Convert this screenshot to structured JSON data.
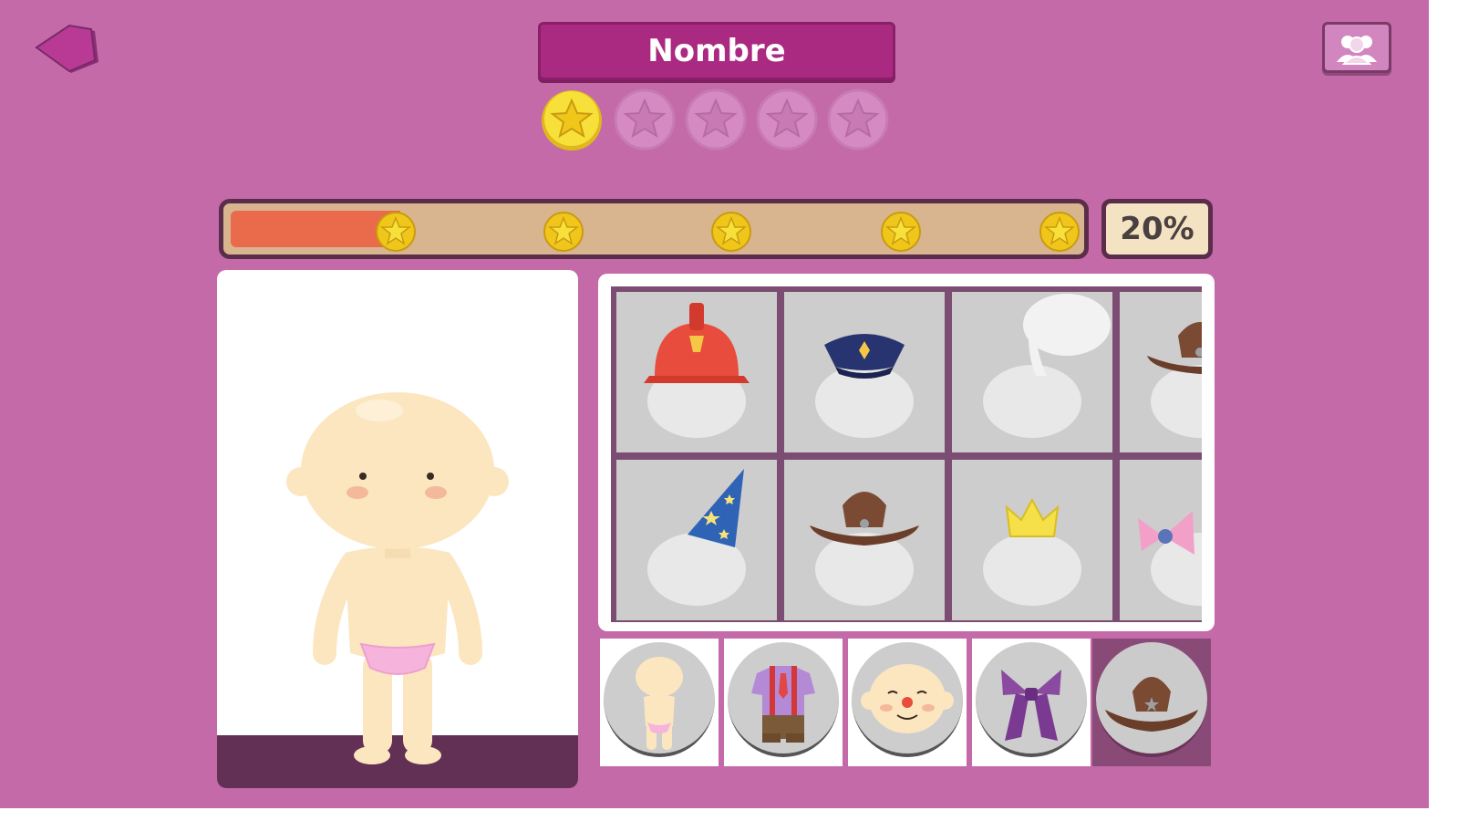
{
  "header": {
    "name_label": "Nombre",
    "back_icon": "back-arrow-icon",
    "users_icon": "users-icon"
  },
  "stars": {
    "earned": 1,
    "total": 5
  },
  "progress": {
    "percent_label": "20%",
    "fraction": 0.2,
    "milestones": 5
  },
  "colors": {
    "background": "#c46aa8",
    "banner": "#aa2981",
    "progress_fill": "#ea6a4c",
    "progress_track": "#d8b58f",
    "star_gold": "#f7e03a",
    "star_empty": "#d68ac2"
  },
  "items": [
    {
      "icon": "fire-helmet-icon",
      "row": 1
    },
    {
      "icon": "police-cap-icon",
      "row": 1
    },
    {
      "icon": "chef-hat-icon",
      "row": 1
    },
    {
      "icon": "cowboy-hat-icon",
      "row": 1
    },
    {
      "icon": "wizard-hat-icon",
      "row": 2
    },
    {
      "icon": "cowboy-hat-icon",
      "row": 2
    },
    {
      "icon": "crown-icon",
      "row": 2
    },
    {
      "icon": "bow-icon",
      "row": 2
    }
  ],
  "categories": [
    {
      "icon": "body-icon",
      "active": false
    },
    {
      "icon": "clothes-icon",
      "active": false
    },
    {
      "icon": "face-icon",
      "active": false
    },
    {
      "icon": "hair-icon",
      "active": false
    },
    {
      "icon": "hat-icon",
      "active": true
    }
  ]
}
